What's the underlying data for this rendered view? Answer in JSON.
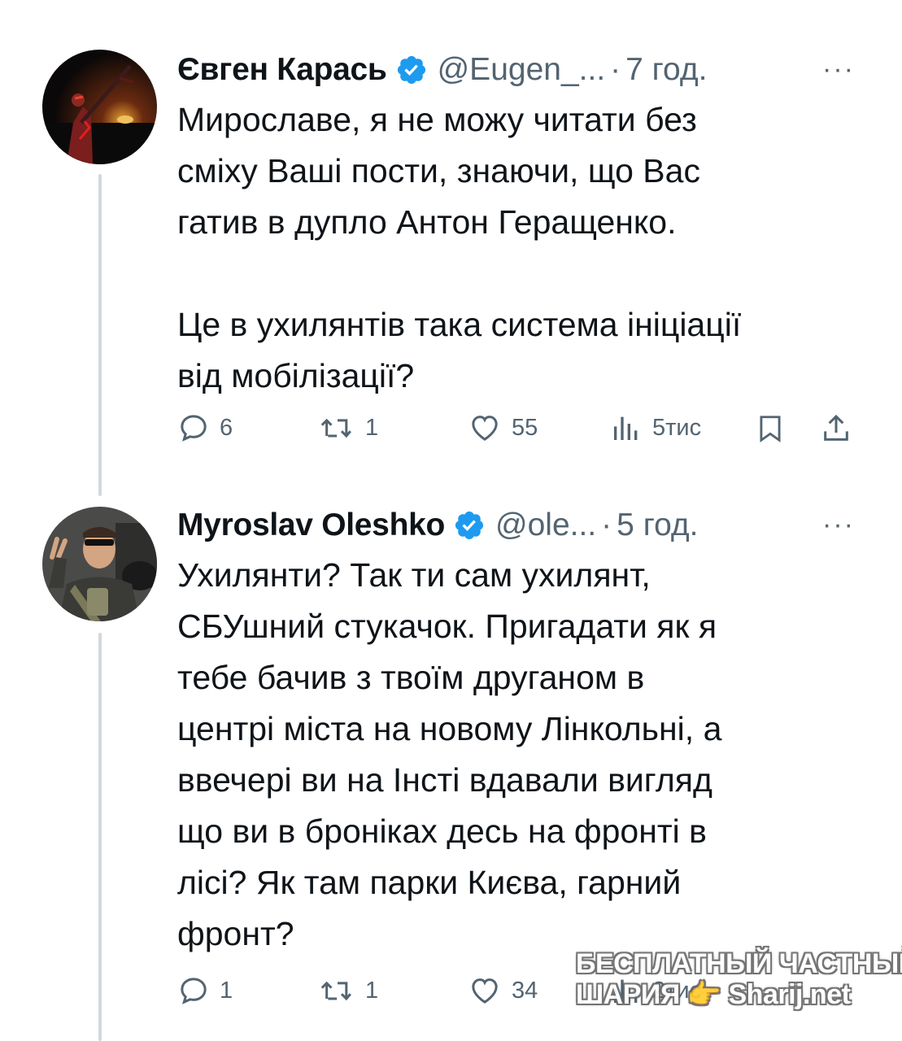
{
  "tweets": [
    {
      "author_name": "Євген Карась",
      "handle": "@Eugen_...",
      "separator": "·",
      "time": "7 год.",
      "more": "···",
      "text": "Мирославе, я не можу читати без\nсміху Ваші пости, знаючи, що Вас\nгатив в дупло Антон Геращенко.\n\nЦе в ухилянтів така система ініціації\nвід мобілізації?",
      "replies": "6",
      "retweets": "1",
      "likes": "55",
      "views": "5тис"
    },
    {
      "author_name": "Myroslav Oleshko",
      "handle": "@ole...",
      "separator": "·",
      "time": "5 год.",
      "more": "···",
      "text": "Ухилянти? Так ти сам ухилянт,\nСБУшний стукачок. Пригадати як я\nтебе бачив з твоїм друганом в\nцентрі міста на новому Лінкольні, а\nввечері ви на Інсті вдавали вигляд\nщо ви в броніках десь на фронті в\nлісі? Як там парки Києва, гарний\nфронт?",
      "replies": "1",
      "retweets": "1",
      "likes": "34",
      "views": "2тис"
    }
  ],
  "watermark": {
    "line1": "БЕСПЛАТНЫЙ ЧАСТНЫЙ",
    "line2": "ШАРИЯ 👉 Sharij.net"
  },
  "colors": {
    "verified": "#1d9bf0",
    "secondary_text": "#536471",
    "thread_line": "#cfd9de"
  }
}
